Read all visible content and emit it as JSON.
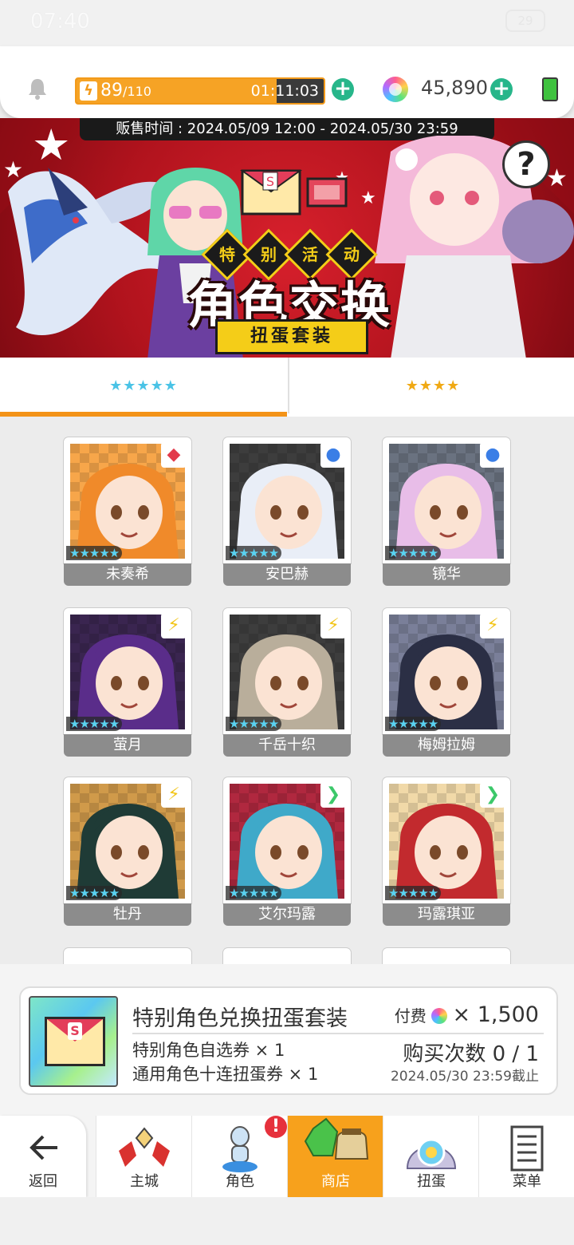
{
  "status_bar": {
    "time": "07:40",
    "battery": "29"
  },
  "resources": {
    "stamina_current": "89",
    "stamina_max": "/110",
    "stamina_fraction": 0.81,
    "stamina_timer": "01:11:03",
    "gem_count": "45,890"
  },
  "banner": {
    "sale_period": "贩售时间 : 2024.05/09 12:00 - 2024.05/30 23:59",
    "tags": [
      "特",
      "别",
      "活",
      "动"
    ],
    "title": "角色交换",
    "subtitle": "扭蛋套装",
    "help_label": "?"
  },
  "tabs": [
    {
      "label": "★★★★★",
      "active": true
    },
    {
      "label": "★★★★",
      "active": false
    }
  ],
  "characters": [
    {
      "name": "未奏希",
      "stars": "★★★★★",
      "attr": "◆",
      "attr_color": "#e23a4b",
      "hair": "#f08a2a",
      "bg": "#f7a64a"
    },
    {
      "name": "安巴赫",
      "stars": "★★★★★",
      "attr": "●",
      "attr_color": "#3a7ee6",
      "hair": "#e9eef7",
      "bg": "#3d3d3d"
    },
    {
      "name": "镜华",
      "stars": "★★★★★",
      "attr": "●",
      "attr_color": "#3a7ee6",
      "hair": "#e8bde8",
      "bg": "#6a7280"
    },
    {
      "name": "萤月",
      "stars": "★★★★★",
      "attr": "⚡",
      "attr_color": "#f2c51a",
      "hair": "#5a2d8a",
      "bg": "#3a2550"
    },
    {
      "name": "千岳十织",
      "stars": "★★★★★",
      "attr": "⚡",
      "attr_color": "#f2c51a",
      "hair": "#b9ae9b",
      "bg": "#3d3d3d"
    },
    {
      "name": "梅姆拉姆",
      "stars": "★★★★★",
      "attr": "⚡",
      "attr_color": "#f2c51a",
      "hair": "#2b2f45",
      "bg": "#7a7f99"
    },
    {
      "name": "牡丹",
      "stars": "★★★★★",
      "attr": "⚡",
      "attr_color": "#f2c51a",
      "hair": "#1f3b36",
      "bg": "#d09a4a"
    },
    {
      "name": "艾尔玛露",
      "stars": "★★★★★",
      "attr": "❯",
      "attr_color": "#3cc86a",
      "hair": "#3fa9c9",
      "bg": "#b0283f"
    },
    {
      "name": "玛露琪亚",
      "stars": "★★★★★",
      "attr": "❯",
      "attr_color": "#3cc86a",
      "hair": "#c22a2e",
      "bg": "#f1d9a8"
    }
  ],
  "package": {
    "title": "特别角色兑换扭蛋套装",
    "item1": "特别角色自选券 × 1",
    "item2": "通用角色十连扭蛋券 × 1",
    "cost_label": "付费",
    "cost_amount": "× 1,500",
    "purchase_count": "购买次数 0 / 1",
    "deadline": "2024.05/30 23:59截止"
  },
  "nav": {
    "back": "返回",
    "items": [
      "主城",
      "角色",
      "商店",
      "扭蛋",
      "菜单"
    ],
    "active": "商店",
    "badge": "!"
  }
}
